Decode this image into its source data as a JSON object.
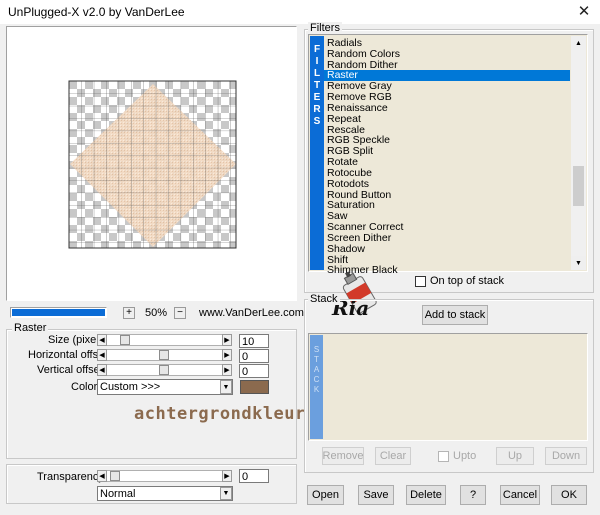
{
  "window": {
    "title": "UnPlugged-X v2.0 by VanDerLee",
    "close_glyph": "✕"
  },
  "preview": {
    "zoom_value": "50%",
    "zoom_plus": "+",
    "zoom_minus": "−",
    "website": "www.VanDerLee.com",
    "progress_fraction": 1.0
  },
  "raster": {
    "group_label": "Raster",
    "size_label": "Size (pixels)",
    "size_value": "10",
    "size_fraction": 0.1,
    "hoffset_label": "Horizontal offset",
    "hoffset_value": "0",
    "hoffset_fraction": 0.5,
    "voffset_label": "Vertical offset",
    "voffset_value": "0",
    "voffset_fraction": 0.5,
    "color_label": "Color",
    "color_value": "Custom >>>",
    "swatch_color": "#8b6a4e",
    "annotation": "achtergrondkleur"
  },
  "bottom_left": {
    "transparency_label": "Transparency",
    "transparency_value": "0",
    "transparency_fraction": 0.0,
    "blend_value": "Normal"
  },
  "filters": {
    "group_label": "Filters",
    "vertical_label": [
      "F",
      "I",
      "L",
      "T",
      "E",
      "R",
      "S"
    ],
    "items": [
      "Radials",
      "Random Colors",
      "Random Dither",
      "Raster",
      "Remove Gray",
      "Remove RGB",
      "Renaissance",
      "Repeat",
      "Rescale",
      "RGB Speckle",
      "RGB Split",
      "Rotate",
      "Rotocube",
      "Rotodots",
      "Round Button",
      "Saturation",
      "Saw",
      "Scanner Correct",
      "Screen Dither",
      "Shadow",
      "Shift",
      "Shimmer Black"
    ],
    "selected": "Raster",
    "on_top_label": "On top of stack"
  },
  "stack": {
    "group_label": "Stack",
    "add_label": "Add to stack",
    "vertical_label": [
      "S",
      "T",
      "A",
      "C",
      "K"
    ],
    "remove_label": "Remove",
    "clear_label": "Clear",
    "upto_label": "Upto",
    "up_label": "Up",
    "down_label": "Down"
  },
  "watermark": {
    "text": "Ria"
  },
  "footer": {
    "open_label": "Open",
    "save_label": "Save",
    "delete_label": "Delete",
    "help_label": "?",
    "cancel_label": "Cancel",
    "ok_label": "OK"
  },
  "icons": {
    "up": "▲",
    "down": "▼",
    "dropdown": "▼",
    "left": "◀",
    "right": "▶"
  }
}
